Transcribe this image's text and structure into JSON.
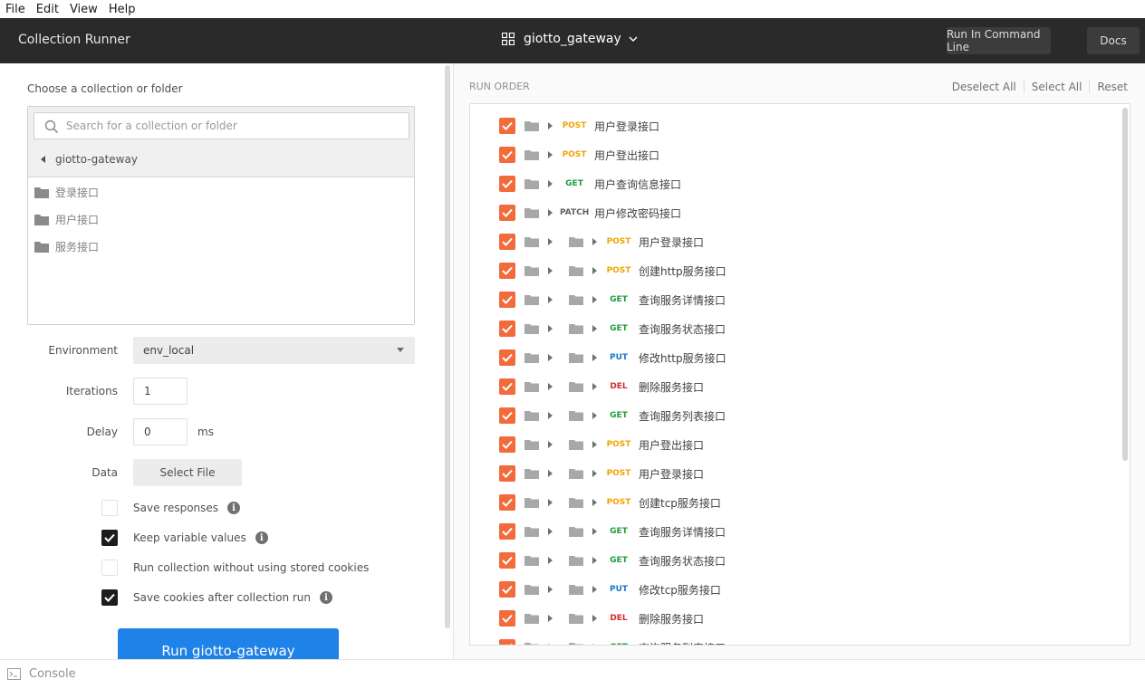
{
  "menubar": [
    "File",
    "Edit",
    "View",
    "Help"
  ],
  "header": {
    "title": "Collection Runner",
    "collection": "giotto_gateway",
    "run_cli": "Run In Command Line",
    "docs": "Docs"
  },
  "left": {
    "choose_label": "Choose a collection or folder",
    "search_placeholder": "Search for a collection or folder",
    "breadcrumb": "giotto-gateway",
    "folders": [
      "登录接口",
      "用户接口",
      "服务接口"
    ],
    "environment_label": "Environment",
    "environment_value": "env_local",
    "iterations_label": "Iterations",
    "iterations_value": "1",
    "delay_label": "Delay",
    "delay_value": "0",
    "delay_unit": "ms",
    "data_label": "Data",
    "select_file": "Select File",
    "options": [
      {
        "label": "Save responses",
        "checked": false,
        "info": true
      },
      {
        "label": "Keep variable values",
        "checked": true,
        "info": true
      },
      {
        "label": "Run collection without using stored cookies",
        "checked": false,
        "info": false
      },
      {
        "label": "Save cookies after collection run",
        "checked": true,
        "info": true
      }
    ],
    "run_button": "Run giotto-gateway"
  },
  "right": {
    "run_order_label": "RUN ORDER",
    "actions": [
      "Deselect All",
      "Select All",
      "Reset"
    ],
    "requests": [
      {
        "depth": 1,
        "method": "POST",
        "name": "用户登录接口"
      },
      {
        "depth": 1,
        "method": "POST",
        "name": "用户登出接口"
      },
      {
        "depth": 1,
        "method": "GET",
        "name": "用户查询信息接口"
      },
      {
        "depth": 1,
        "method": "PATCH",
        "name": "用户修改密码接口"
      },
      {
        "depth": 2,
        "method": "POST",
        "name": "用户登录接口"
      },
      {
        "depth": 2,
        "method": "POST",
        "name": "创建http服务接口"
      },
      {
        "depth": 2,
        "method": "GET",
        "name": "查询服务详情接口"
      },
      {
        "depth": 2,
        "method": "GET",
        "name": "查询服务状态接口"
      },
      {
        "depth": 2,
        "method": "PUT",
        "name": "修改http服务接口"
      },
      {
        "depth": 2,
        "method": "DEL",
        "name": "删除服务接口"
      },
      {
        "depth": 2,
        "method": "GET",
        "name": "查询服务列表接口"
      },
      {
        "depth": 2,
        "method": "POST",
        "name": "用户登出接口"
      },
      {
        "depth": 2,
        "method": "POST",
        "name": "用户登录接口"
      },
      {
        "depth": 2,
        "method": "POST",
        "name": "创建tcp服务接口"
      },
      {
        "depth": 2,
        "method": "GET",
        "name": "查询服务详情接口"
      },
      {
        "depth": 2,
        "method": "GET",
        "name": "查询服务状态接口"
      },
      {
        "depth": 2,
        "method": "PUT",
        "name": "修改tcp服务接口"
      },
      {
        "depth": 2,
        "method": "DEL",
        "name": "删除服务接口"
      },
      {
        "depth": 2,
        "method": "GET",
        "name": "查询服务列表接口"
      }
    ]
  },
  "footer": {
    "console": "Console"
  },
  "colors": {
    "header_bg": "#2a2a2a",
    "accent_orange": "#f26b3a",
    "run_blue": "#1f82e8",
    "method_post": "#f0a400",
    "method_get": "#1f9d3a",
    "method_put": "#1a76d0",
    "method_del": "#d62b2b"
  }
}
